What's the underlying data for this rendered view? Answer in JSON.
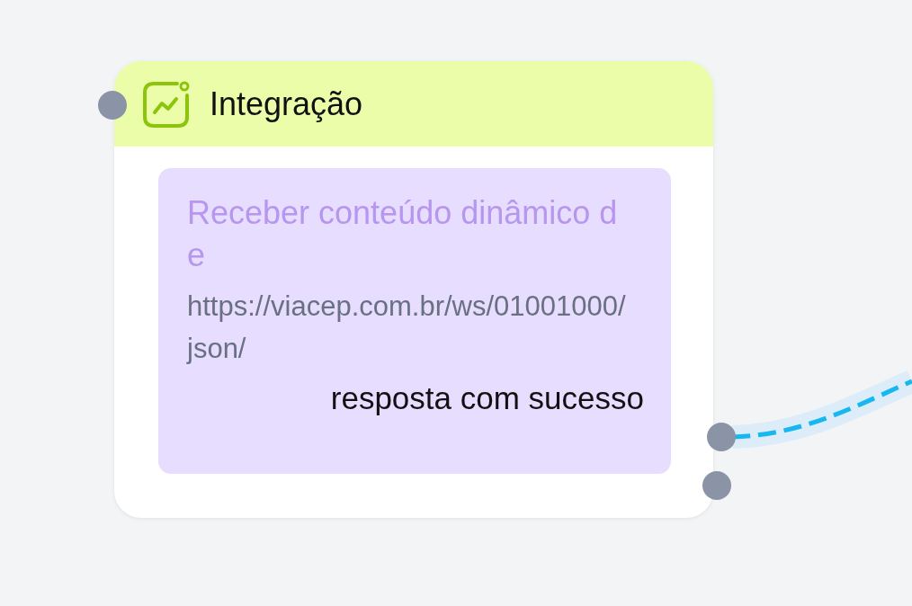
{
  "node": {
    "title": "Integração",
    "action": "Receber conteúdo dinâmico de",
    "url": "https://viacep.com.br/ws/01001000/json/",
    "output_label": "resposta com sucesso"
  }
}
